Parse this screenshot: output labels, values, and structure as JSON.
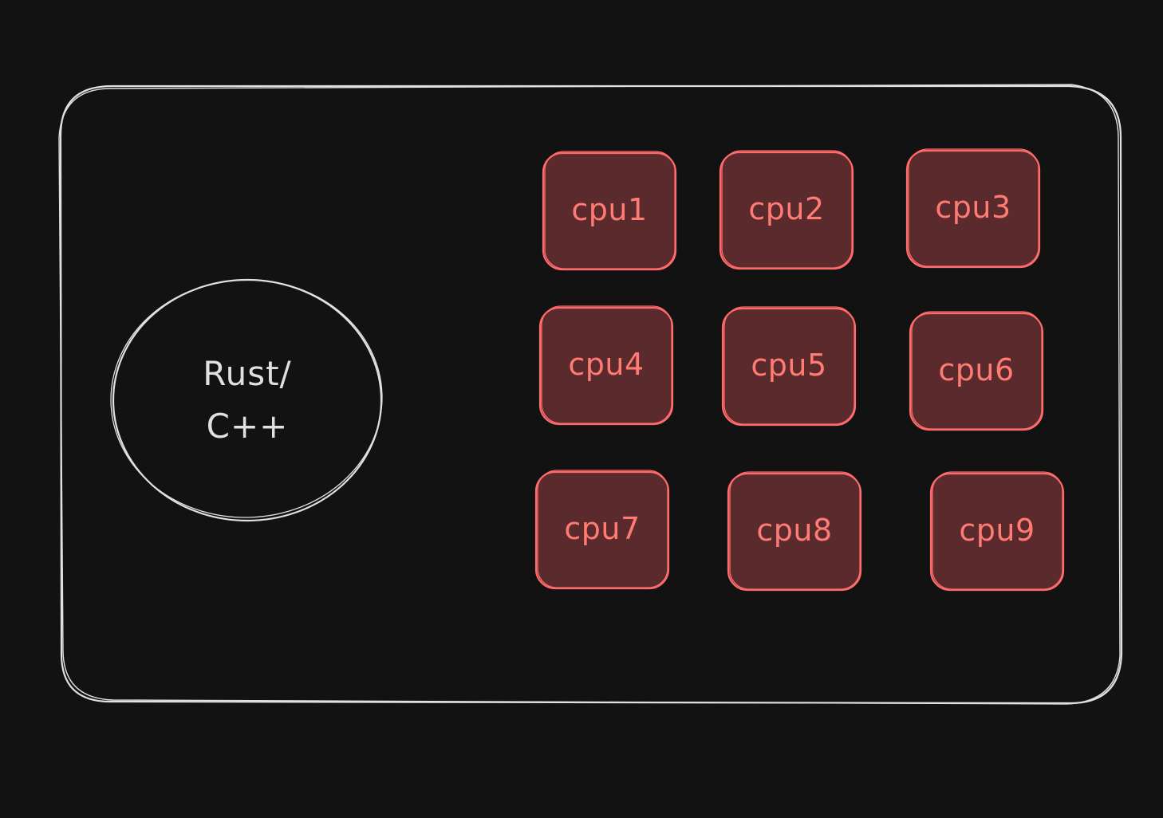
{
  "runtime": {
    "line1": "Rust/",
    "line2": "C++"
  },
  "cpus": [
    "cpu1",
    "cpu2",
    "cpu3",
    "cpu4",
    "cpu5",
    "cpu6",
    "cpu7",
    "cpu8",
    "cpu9"
  ],
  "colors": {
    "background": "#121212",
    "outline": "#e0e0e0",
    "cpu_stroke": "#ff6b6b",
    "cpu_fill": "#5b2a2c",
    "cpu_text": "#ff7b73"
  }
}
